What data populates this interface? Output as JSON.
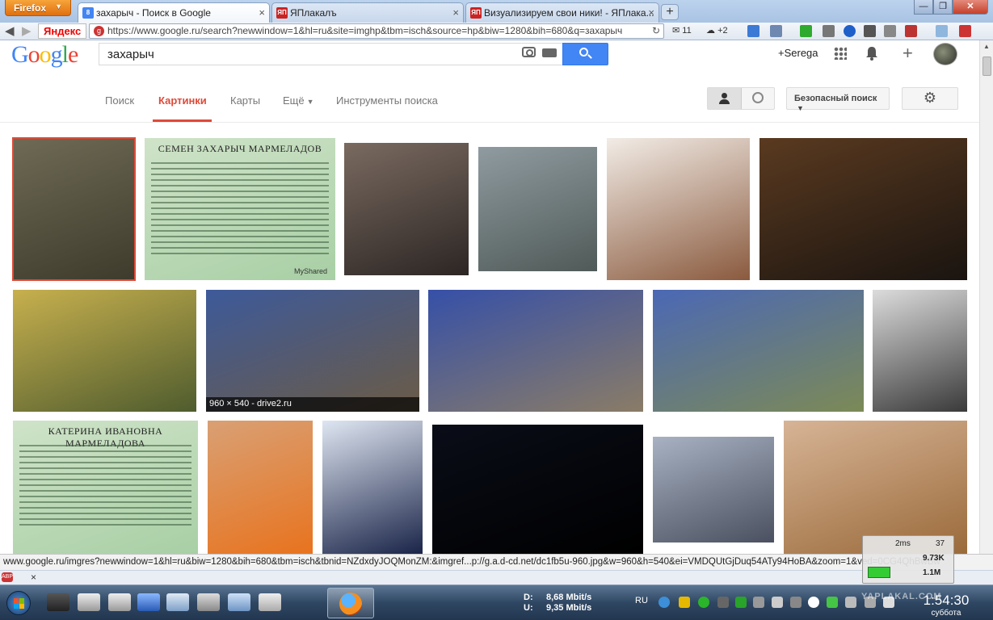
{
  "browser": {
    "menu_button": "Firefox",
    "tabs": [
      {
        "label": "захарыч - Поиск в Google",
        "favicon": "8",
        "color": "#4285f4",
        "active": true
      },
      {
        "label": "ЯПлакалъ",
        "favicon": "ЯП",
        "color": "#cc2222",
        "active": false
      },
      {
        "label": "Визуализируем свои ники! - ЯПлака...",
        "favicon": "ЯП",
        "color": "#cc2222",
        "active": false
      }
    ],
    "new_tab": "+",
    "window_min": "—",
    "window_max": "❐",
    "window_close": "✕",
    "yandex_bar": "Яндекс",
    "url": "https://www.google.ru/search?newwindow=1&hl=ru&site=imghp&tbm=isch&source=hp&biw=1280&bih=680&q=захарыч",
    "mail_count": "11",
    "weather": "+2"
  },
  "google": {
    "logo": [
      "G",
      "o",
      "o",
      "g",
      "l",
      "e"
    ],
    "logo_colors": [
      "#4285f4",
      "#ea4335",
      "#fbbc05",
      "#4285f4",
      "#34a853",
      "#ea4335"
    ],
    "query": "захарыч",
    "user_link": "+Serega",
    "tabs": [
      {
        "label": "Поиск"
      },
      {
        "label": "Картинки",
        "selected": true
      },
      {
        "label": "Карты"
      },
      {
        "label": "Ещё"
      },
      {
        "label": "Инструменты поиска"
      }
    ],
    "safe_search": "Безопасный поиск",
    "accent": "#dd4b39"
  },
  "images": [
    {
      "alt": "Old man in cap",
      "colors": [
        "#6e6a55",
        "#3e3b2c"
      ]
    },
    {
      "alt": "Семен Захарыч Мармеладов slide",
      "title": "СЕМЕН ЗАХАРЫЧ МАРМЕЛАДОВ",
      "watermark": "MyShared",
      "colors": [
        "#cfe3c8",
        "#a8cfa5"
      ]
    },
    {
      "alt": "Man with cap and cigarette",
      "colors": [
        "#7a6a60",
        "#2c2624"
      ]
    },
    {
      "alt": "Man carrying box on street",
      "colors": [
        "#8f9ba0",
        "#505a58"
      ]
    },
    {
      "alt": "Caricature smiling face",
      "colors": [
        "#f2ece6",
        "#8a5a3e"
      ]
    },
    {
      "alt": "Man in hat pointing",
      "colors": [
        "#5a3a20",
        "#1a1410"
      ]
    },
    {
      "alt": "Old truck in autumn forest",
      "colors": [
        "#c7b04e",
        "#4f5c2e"
      ]
    },
    {
      "alt": "Blue car front",
      "caption": "960 × 540 - drive2.ru",
      "colors": [
        "#3d5a9a",
        "#6b5b45"
      ]
    },
    {
      "alt": "Blue hatchback side",
      "colors": [
        "#3650a8",
        "#8a7c66"
      ]
    },
    {
      "alt": "Blue car rear",
      "colors": [
        "#4b68b5",
        "#7c8a56"
      ]
    },
    {
      "alt": "Engraving portrait of bearded man",
      "colors": [
        "#dcdcdc",
        "#3a3a3a"
      ]
    },
    {
      "alt": "Катерина Ивановна Мармеладова slide",
      "title": "КАТЕРИНА ИВАНОВНА МАРМЕЛАДОВА",
      "colors": [
        "#cfe3c8",
        "#a8cfa5"
      ]
    },
    {
      "alt": "Smiling man in orange shirt",
      "colors": [
        "#d9a074",
        "#e8731e"
      ]
    },
    {
      "alt": "Anime character Sasuke",
      "colors": [
        "#dfe6f2",
        "#1a2448"
      ]
    },
    {
      "alt": "Fireworks at night",
      "colors": [
        "#0a0d18",
        "#000000"
      ]
    },
    {
      "alt": "Man sitting on silver car",
      "colors": [
        "#a8b2c2",
        "#4a5060"
      ]
    },
    {
      "alt": "Man in wooden barrel bath",
      "colors": [
        "#d7b496",
        "#9a6a3a"
      ]
    }
  ],
  "status_url": "www.google.ru/imgres?newwindow=1&hl=ru&biw=1280&bih=680&tbm=isch&tbnid=NZdxdyJOQMonZM:&imgref...p://g.a.d-cd.net/dc1fb5u-960.jpg&w=960&h=540&ei=VMDQUtGjDuq54ATy94HoBA&zoom=1&ved=0CG4QhBwBw",
  "widget": {
    "ping": "2ms",
    "count": "37",
    "down": "9.73K",
    "up": "1.1M"
  },
  "taskbar": {
    "down_label": "D:",
    "down_speed": "8,68 Mbit/s",
    "up_label": "U:",
    "up_speed": "9,35 Mbit/s",
    "language": "RU",
    "time": "1:54:30",
    "day": "суббота",
    "watermark": "YAPLAKAL.COM"
  }
}
